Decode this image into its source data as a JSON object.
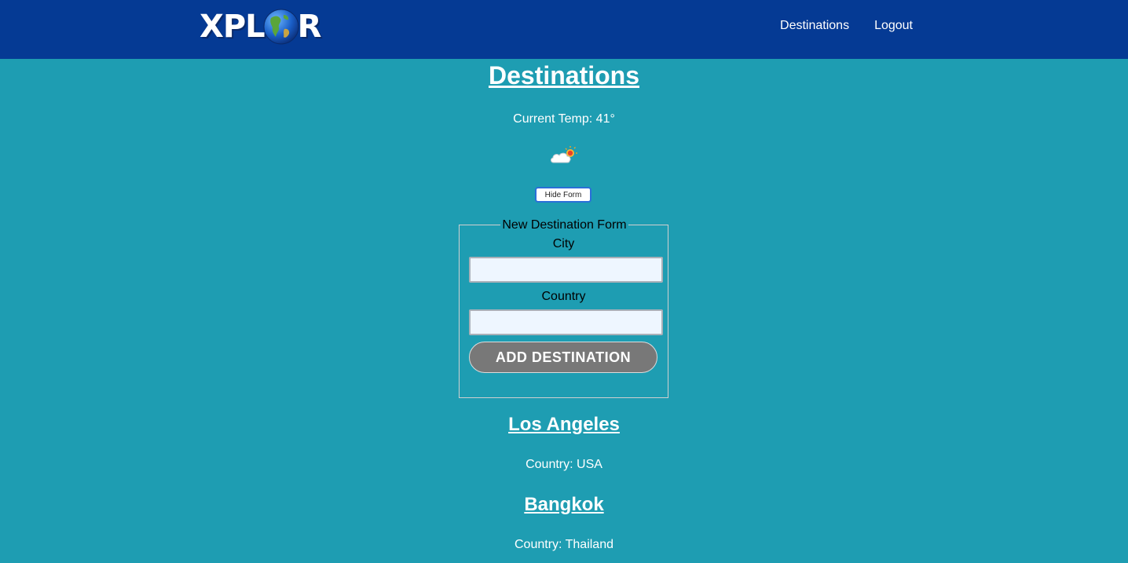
{
  "navbar": {
    "logo_text_left": "XPL",
    "logo_text_right": "R",
    "links": [
      "Destinations",
      "Logout"
    ]
  },
  "page": {
    "title": "Destinations",
    "current_temp": "Current Temp: 41°",
    "weather_icon": "cloud-sun-icon",
    "hide_form_label": "Hide Form"
  },
  "form": {
    "legend": "New Destination Form",
    "city_label": "City",
    "city_value": "",
    "country_label": "Country",
    "country_value": "",
    "submit_label": "ADD DESTINATION"
  },
  "destinations": [
    {
      "city": "Los Angeles",
      "country": "Country: USA"
    },
    {
      "city": "Bangkok",
      "country": "Country: Thailand"
    }
  ],
  "colors": {
    "background": "#1e9db2",
    "navbar": "#053a94",
    "button_gray": "#787878",
    "input_bg": "#eef6ff"
  }
}
